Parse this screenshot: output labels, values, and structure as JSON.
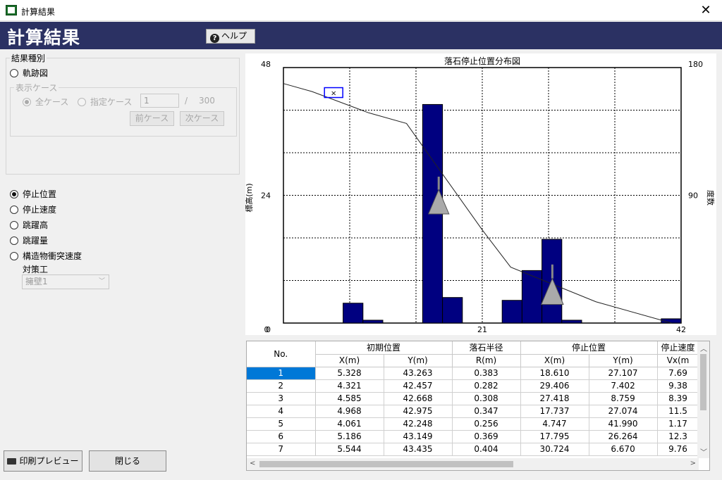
{
  "window": {
    "title": "計算結果",
    "close_label": "✕"
  },
  "banner": {
    "title": "計算結果",
    "help_label": "ヘルプ"
  },
  "left": {
    "group_label": "結果種別",
    "trajectory_label": "軌跡図",
    "display_case_label": "表示ケース",
    "all_case_label": "全ケース",
    "specified_case_label": "指定ケース",
    "case_value": "1",
    "case_sep": "/",
    "case_total": "300",
    "prev_case_label": "前ケース",
    "next_case_label": "次ケース",
    "options": [
      "停止位置",
      "停止速度",
      "跳躍高",
      "跳躍量",
      "構造物衝突速度"
    ],
    "selected_option": "停止位置",
    "countermeasure_label": "対策工",
    "countermeasure_value": "擁壁1",
    "print_preview_label": "印刷プレビュー",
    "close_button_label": "閉じる"
  },
  "chart_data": {
    "type": "bar",
    "title": "落石停止位置分布図",
    "ylabel": "標高(m)",
    "y2label": "度数",
    "xlim": [
      0,
      42
    ],
    "ylim": [
      0,
      48
    ],
    "y2lim": [
      0,
      180
    ],
    "x_ticks": [
      "0",
      "21",
      "42"
    ],
    "y_ticks": [
      "0",
      "24",
      "48"
    ],
    "y2_ticks": [
      "90",
      "180"
    ],
    "grid": true,
    "bin_width": 2.1,
    "bins": [
      {
        "x_start": 6.3,
        "freq": 14
      },
      {
        "x_start": 8.4,
        "freq": 2
      },
      {
        "x_start": 14.7,
        "freq": 154
      },
      {
        "x_start": 16.8,
        "freq": 18
      },
      {
        "x_start": 23.1,
        "freq": 16
      },
      {
        "x_start": 25.2,
        "freq": 37
      },
      {
        "x_start": 27.3,
        "freq": 59
      },
      {
        "x_start": 29.4,
        "freq": 2
      },
      {
        "x_start": 39.9,
        "freq": 3
      }
    ],
    "profile": [
      [
        0,
        45
      ],
      [
        3,
        43.5
      ],
      [
        9,
        39.5
      ],
      [
        13,
        37.5
      ],
      [
        21,
        17.5
      ],
      [
        24,
        10.5
      ],
      [
        33,
        4
      ],
      [
        41,
        0
      ]
    ],
    "start_marker": {
      "x": 5.3,
      "y": 43.3,
      "label": "×"
    },
    "structure_markers": [
      {
        "x": 16.4,
        "top": 27.5,
        "bottom": 20.5
      },
      {
        "x": 28.4,
        "top": 11,
        "bottom": 3.5
      }
    ],
    "color": "#000080"
  },
  "table": {
    "headers_top": [
      "No.",
      "初期位置",
      "落石半径",
      "停止位置",
      "停止速度"
    ],
    "headers_sub": [
      "X(m)",
      "Y(m)",
      "R(m)",
      "X(m)",
      "Y(m)",
      "Vx(m"
    ],
    "rows": [
      [
        "1",
        "5.328",
        "43.263",
        "0.383",
        "18.610",
        "27.107",
        "7.69"
      ],
      [
        "2",
        "4.321",
        "42.457",
        "0.282",
        "29.406",
        "7.402",
        "9.38"
      ],
      [
        "3",
        "4.585",
        "42.668",
        "0.308",
        "27.418",
        "8.759",
        "8.39"
      ],
      [
        "4",
        "4.968",
        "42.975",
        "0.347",
        "17.737",
        "27.074",
        "11.5"
      ],
      [
        "5",
        "4.061",
        "42.248",
        "0.256",
        "4.747",
        "41.990",
        "1.17"
      ],
      [
        "6",
        "5.186",
        "43.149",
        "0.369",
        "17.795",
        "26.264",
        "12.3"
      ],
      [
        "7",
        "5.544",
        "43.435",
        "0.404",
        "30.724",
        "6.670",
        "9.76"
      ]
    ]
  }
}
